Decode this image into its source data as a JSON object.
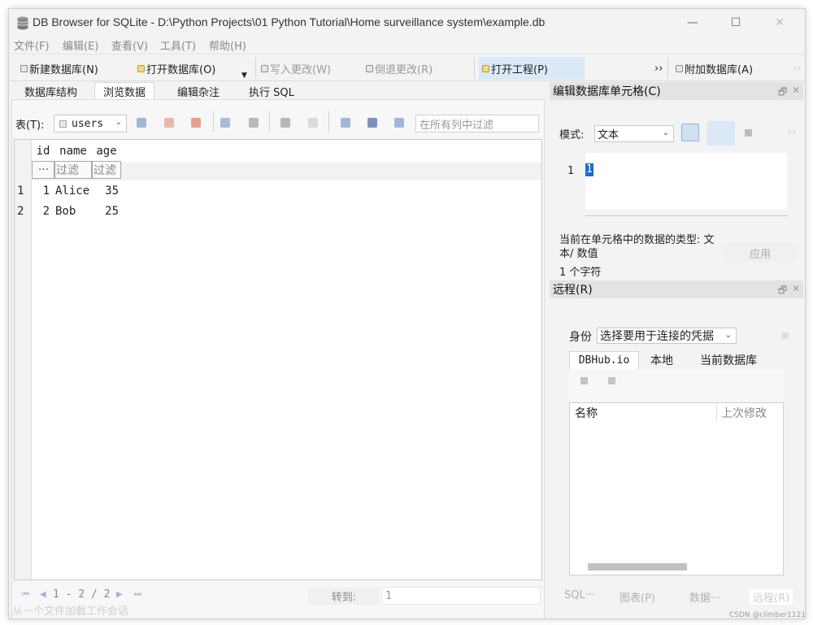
{
  "window": {
    "title": "DB Browser for SQLite - D:\\Python Projects\\01 Python Tutorial\\Home surveillance system\\example.db",
    "minimize": "—",
    "maximize": "☐",
    "close": "✕"
  },
  "menu": [
    "文件(F)",
    "编辑(E)",
    "查看(V)",
    "工具(T)",
    "帮助(H)"
  ],
  "toolbar": {
    "new_db": "新建数据库(N)",
    "open_db": "打开数据库(O)",
    "write_changes": "写入更改(W)",
    "revert_changes": "倒退更改(R)",
    "open_project": "打开工程(P)",
    "overflow": "››",
    "attach_db": "附加数据库(A)",
    "overflow2": "››"
  },
  "main_tabs": [
    "数据库结构",
    "浏览数据",
    "编辑杂注",
    "执行 SQL"
  ],
  "browse": {
    "table_label": "表(T):",
    "table_value": "users",
    "filter_all_placeholder": "在所有列中过滤",
    "columns": [
      "id",
      "name",
      "age"
    ],
    "filter_ellipsis": "···",
    "filter_placeholder": "过滤",
    "rows": [
      {
        "num": "1",
        "id": "1",
        "name": "Alice",
        "age": "35"
      },
      {
        "num": "2",
        "id": "2",
        "name": "Bob",
        "age": "25"
      }
    ],
    "pager_text": "1 - 2 / 2",
    "goto_label": "转到:",
    "goto_value": "1"
  },
  "status_bar": "从一个文件加载工作会话",
  "edit_cell": {
    "title": "编辑数据库单元格(C)",
    "mode_label": "模式:",
    "mode_value": "文本",
    "line_number": "1",
    "value": "1",
    "type_info": "当前在单元格中的数据的类型: 文本/ 数值",
    "char_count": "1 个字符",
    "apply": "应用",
    "overflow": "››"
  },
  "remote": {
    "title": "远程(R)",
    "identity_label": "身份",
    "identity_value": "选择要用于连接的凭据",
    "tabs": [
      "DBHub.io",
      "本地",
      "当前数据库"
    ],
    "columns": [
      "名称",
      "上次修改"
    ]
  },
  "bottom_tabs": [
    "SQL···",
    "图表(P)",
    "数据···",
    "远程(R)"
  ],
  "watermark": "CSDN @climber1121"
}
